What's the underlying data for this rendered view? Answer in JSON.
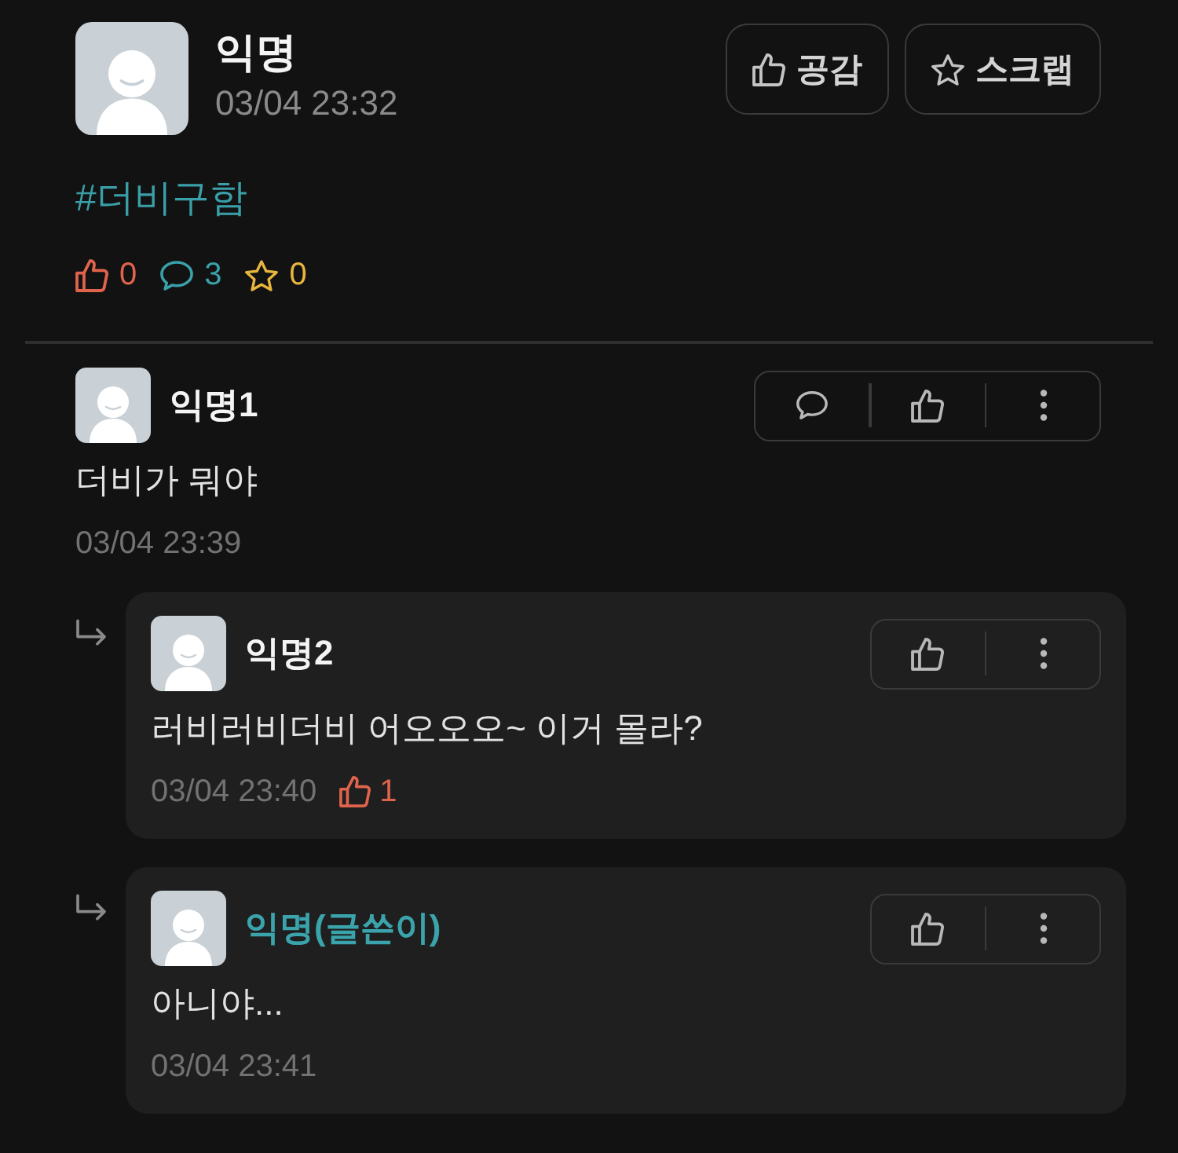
{
  "post": {
    "author": "익명",
    "time": "03/04 23:32",
    "actions": [
      {
        "kind": "like",
        "label": "공감"
      },
      {
        "kind": "scrap",
        "label": "스크랩"
      }
    ],
    "hashtag": "#더비구함",
    "stats": [
      {
        "kind": "like",
        "count": "0",
        "color": "#e0634c"
      },
      {
        "kind": "comment",
        "count": "3",
        "color": "#3aa0a9"
      },
      {
        "kind": "scrap",
        "count": "0",
        "color": "#e8b53e"
      }
    ]
  },
  "comments": [
    {
      "author": "익명1",
      "is_author": false,
      "text": "더비가 뭐야",
      "time": "03/04 23:39",
      "actions": [
        {
          "kind": "reply"
        },
        {
          "kind": "like"
        },
        {
          "kind": "more"
        }
      ],
      "children": [
        {
          "author": "익명2",
          "is_author": false,
          "text": "러비러비더비 어오오오~ 이거 몰라?",
          "time": "03/04 23:40",
          "likes": "1",
          "actions": [
            {
              "kind": "like"
            },
            {
              "kind": "more"
            }
          ]
        },
        {
          "author": "익명(글쓴이)",
          "is_author": true,
          "text": "아니야...",
          "time": "03/04 23:41",
          "actions": [
            {
              "kind": "like"
            },
            {
              "kind": "more"
            }
          ]
        }
      ]
    }
  ]
}
